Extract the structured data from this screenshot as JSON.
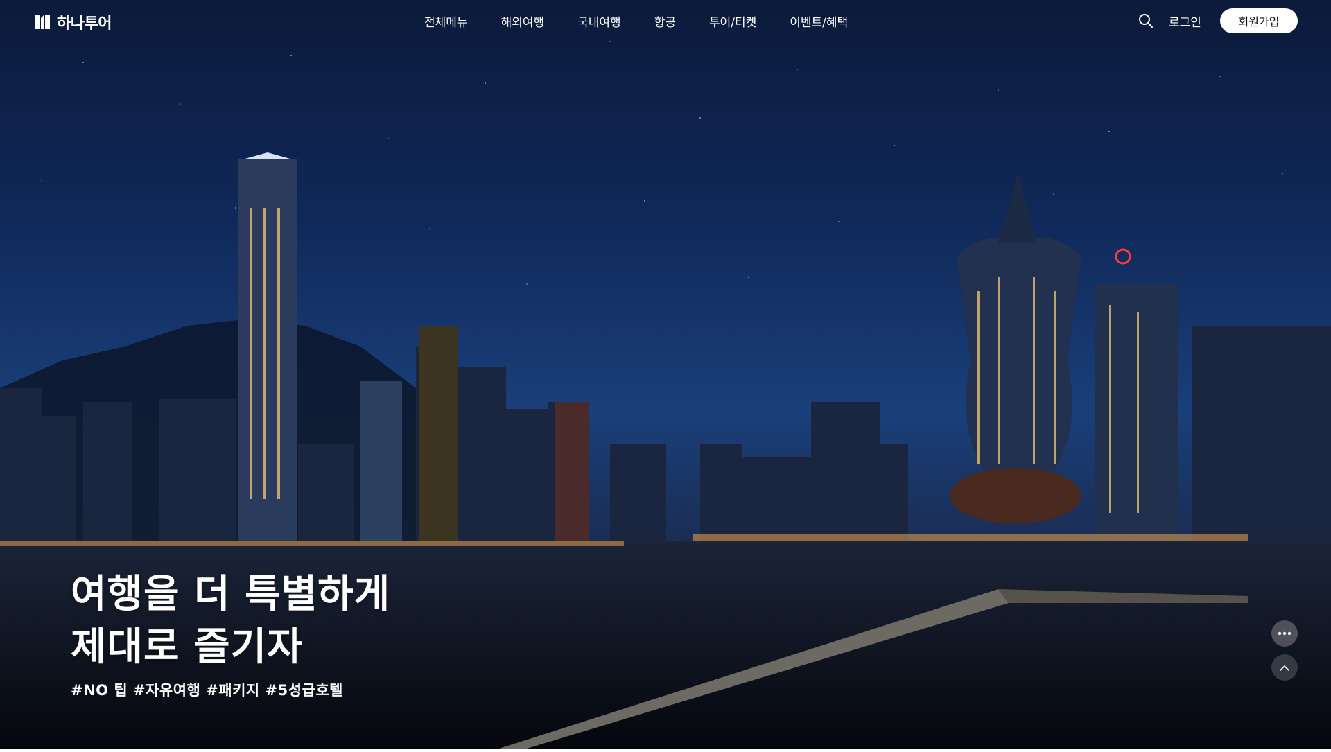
{
  "brand": {
    "name": "하나투어"
  },
  "nav": {
    "items": [
      {
        "label": "전체메뉴"
      },
      {
        "label": "해외여행"
      },
      {
        "label": "국내여행"
      },
      {
        "label": "항공"
      },
      {
        "label": "투어/티켓"
      },
      {
        "label": "이벤트/혜택"
      }
    ]
  },
  "header": {
    "login_label": "로그인",
    "signup_label": "회원가입",
    "search_icon": "search-icon"
  },
  "hero": {
    "headline_line1": "여행을 더 특별하게",
    "headline_line2": "제대로 즐기자",
    "hashtags": "#NO 팁 #자유여행 #패키지 #5성급호텔"
  },
  "floating": {
    "more_icon": "more-dots-icon",
    "top_icon": "chevron-up-icon"
  },
  "colors": {
    "sky_top": "#0b1a3a",
    "sky_mid": "#1a3f7a",
    "text": "#ffffff"
  }
}
